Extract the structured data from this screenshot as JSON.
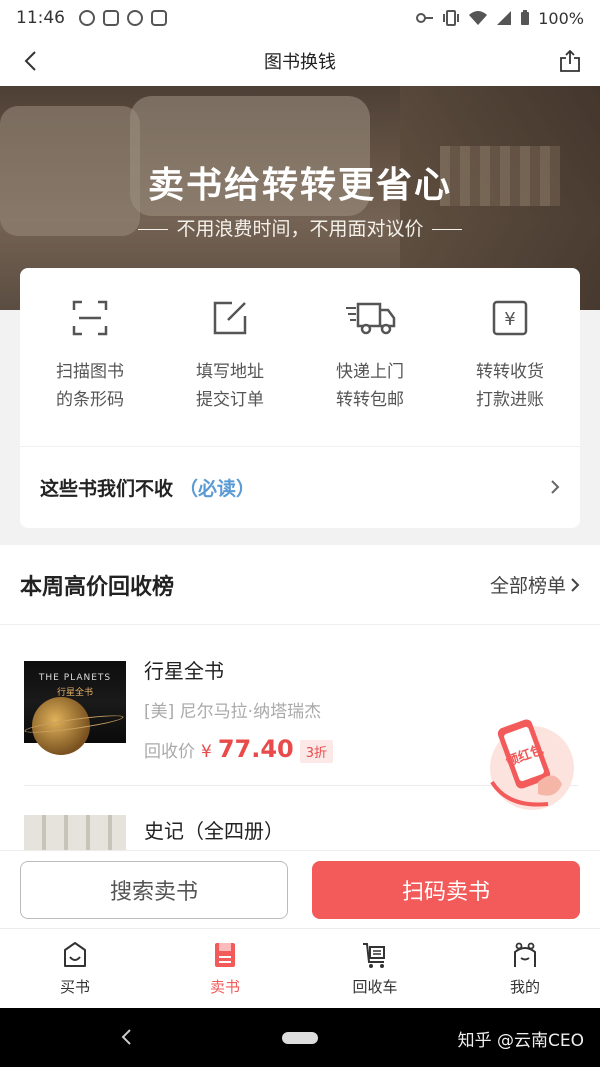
{
  "status_bar": {
    "time": "11:46",
    "battery": "100%"
  },
  "nav": {
    "title": "图书换钱"
  },
  "hero": {
    "headline": "卖书给转转更省心",
    "subtitle": "不用浪费时间，不用面对议价"
  },
  "steps": [
    {
      "line1": "扫描图书",
      "line2": "的条形码",
      "icon": "scan-icon"
    },
    {
      "line1": "填写地址",
      "line2": "提交订单",
      "icon": "edit-icon"
    },
    {
      "line1": "快递上门",
      "line2": "转转包邮",
      "icon": "truck-icon"
    },
    {
      "line1": "转转收货",
      "line2": "打款进账",
      "icon": "yen-icon"
    }
  ],
  "notice": {
    "text": "这些书我们不收",
    "must_read": "（必读）"
  },
  "rank": {
    "title": "本周高价回收榜",
    "all_label": "全部榜单",
    "books": [
      {
        "name": "行星全书",
        "author": "[美] 尼尔马拉·纳塔瑞杰",
        "price_label": "回收价",
        "currency": "¥",
        "price": "77.40",
        "discount": "3折",
        "cover_title": "THE PLANETS",
        "cover_subtitle": "行星全书"
      },
      {
        "name": "史记（全四册）"
      }
    ]
  },
  "redpacket": {
    "text": "领红包"
  },
  "actions": {
    "search": "搜索卖书",
    "scan": "扫码卖书"
  },
  "tabs": [
    {
      "label": "买书",
      "icon": "buy-icon"
    },
    {
      "label": "卖书",
      "icon": "sell-icon",
      "active": true
    },
    {
      "label": "回收车",
      "icon": "cart-icon"
    },
    {
      "label": "我的",
      "icon": "profile-icon"
    }
  ],
  "watermark": "知乎 @云南CEO",
  "colors": {
    "accent": "#f35a5a",
    "link": "#5b9bd5"
  }
}
